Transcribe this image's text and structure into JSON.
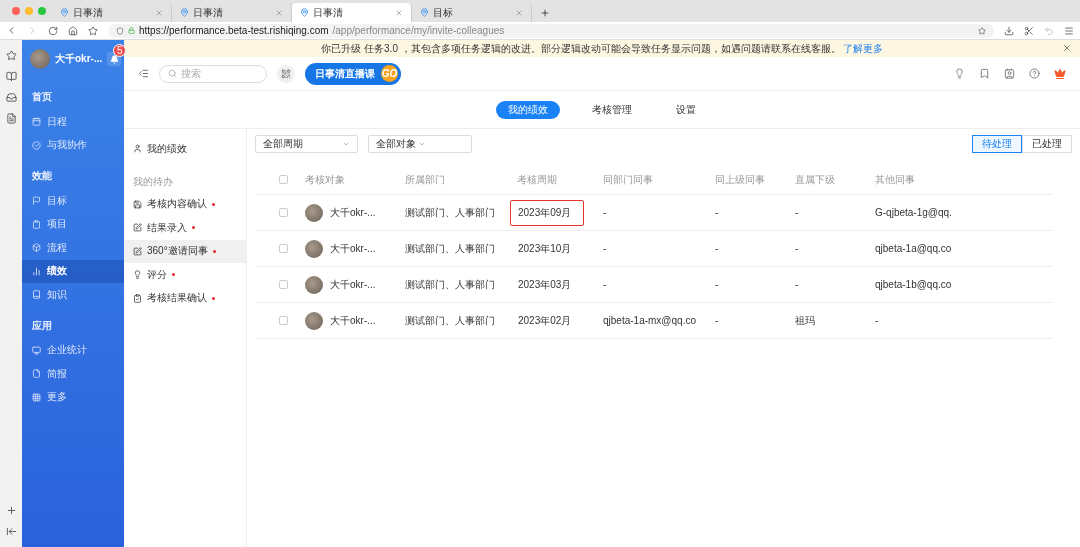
{
  "browser": {
    "tabs": [
      {
        "title": "日事清",
        "selected": false
      },
      {
        "title": "日事清",
        "selected": false
      },
      {
        "title": "日事清",
        "selected": true
      },
      {
        "title": "目标",
        "selected": false
      }
    ],
    "url_host": "https://performance.beta-test.rishiqing.com",
    "url_path": "/app/performance/my/invite-colleagues"
  },
  "notice": {
    "text": "你已升级 任务3.0 ，其包含多项任务逻辑的改进。部分逻辑改动可能会导致任务显示问题，如遇问题请联系在线客服。",
    "link": "了解更多"
  },
  "sidebar": {
    "user": {
      "name": "大千okr-...",
      "badge": "5"
    },
    "sections": [
      {
        "heading": "首页",
        "items": [
          {
            "label": "日程",
            "selected": false
          },
          {
            "label": "与我协作",
            "selected": false
          }
        ]
      },
      {
        "heading": "效能",
        "items": [
          {
            "label": "目标",
            "selected": false
          },
          {
            "label": "项目",
            "selected": false
          },
          {
            "label": "流程",
            "selected": false
          },
          {
            "label": "绩效",
            "selected": true
          },
          {
            "label": "知识",
            "selected": false
          }
        ]
      },
      {
        "heading": "应用",
        "items": [
          {
            "label": "企业统计",
            "selected": false
          },
          {
            "label": "简报",
            "selected": false
          },
          {
            "label": "更多",
            "selected": false
          }
        ]
      }
    ]
  },
  "header": {
    "search_placeholder": "搜索",
    "live_button": "日事清直播课",
    "live_badge": "GO"
  },
  "tabs": [
    {
      "label": "我的绩效",
      "selected": true
    },
    {
      "label": "考核管理",
      "selected": false
    },
    {
      "label": "设置",
      "selected": false
    }
  ],
  "left_menu": {
    "mine": "我的绩效",
    "todo_heading": "我的待办",
    "todos": [
      {
        "label": "考核内容确认",
        "selected": false,
        "dot": true
      },
      {
        "label": "结果录入",
        "selected": false,
        "dot": true
      },
      {
        "label": "360°邀请同事",
        "selected": true,
        "dot": true
      },
      {
        "label": "评分",
        "selected": false,
        "dot": true
      },
      {
        "label": "考核结果确认",
        "selected": false,
        "dot": true
      }
    ]
  },
  "filters": [
    "全部周期",
    "全部对象"
  ],
  "segment": [
    {
      "label": "待处理",
      "selected": true
    },
    {
      "label": "已处理",
      "selected": false
    }
  ],
  "table": {
    "header_checked": false,
    "columns": [
      "考核对象",
      "所属部门",
      "考核周期",
      "同部门同事",
      "同上级同事",
      "直属下级",
      "其他同事"
    ],
    "rows": [
      {
        "checked": false,
        "period_marked": true,
        "cells": [
          "大千okr-...",
          "测试部门、人事部门",
          "2023年09月",
          "-",
          "-",
          "-",
          "G-qjbeta-1g@qq."
        ]
      },
      {
        "checked": false,
        "period_marked": false,
        "cells": [
          "大千okr-...",
          "测试部门、人事部门",
          "2023年10月",
          "-",
          "-",
          "-",
          "qjbeta-1a@qq.co"
        ]
      },
      {
        "checked": false,
        "period_marked": false,
        "cells": [
          "大千okr-...",
          "测试部门、人事部门",
          "2023年03月",
          "-",
          "-",
          "-",
          "qjbeta-1b@qq.co"
        ]
      },
      {
        "checked": false,
        "period_marked": false,
        "cells": [
          "大千okr-...",
          "测试部门、人事部门",
          "2023年02月",
          "qjbeta-1a-mx@qq.co",
          "-",
          "祖玛",
          "-"
        ]
      }
    ]
  }
}
